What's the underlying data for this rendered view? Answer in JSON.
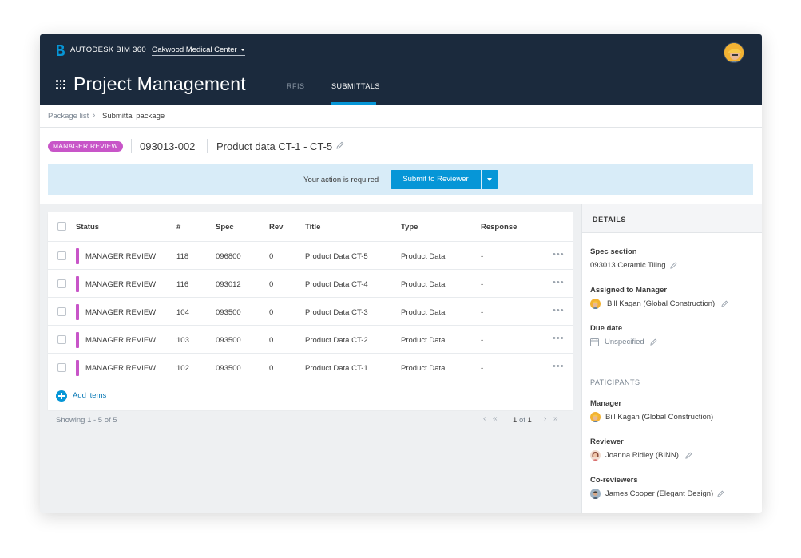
{
  "header": {
    "brand": "AUTODESK BIM 360",
    "project": "Oakwood Medical Center",
    "app_title": "Project Management",
    "tabs": [
      {
        "label": "RFIS",
        "active": false
      },
      {
        "label": "SUBMITTALS",
        "active": true
      }
    ]
  },
  "breadcrumb": {
    "parent": "Package list",
    "current": "Submittal package"
  },
  "package": {
    "status": "MANAGER REVIEW",
    "id": "093013-002",
    "title": "Product data CT-1 - CT-5"
  },
  "action": {
    "message": "Your action is required",
    "button": "Submit to Reviewer"
  },
  "table": {
    "columns": [
      "Status",
      "#",
      "Spec",
      "Rev",
      "Title",
      "Type",
      "Response"
    ],
    "rows": [
      {
        "status": "MANAGER REVIEW",
        "num": "118",
        "spec": "096800",
        "rev": "0",
        "title": "Product Data CT-5",
        "type": "Product Data",
        "response": "-"
      },
      {
        "status": "MANAGER REVIEW",
        "num": "116",
        "spec": "093012",
        "rev": "0",
        "title": "Product Data CT-4",
        "type": "Product Data",
        "response": "-"
      },
      {
        "status": "MANAGER REVIEW",
        "num": "104",
        "spec": "093500",
        "rev": "0",
        "title": "Product Data CT-3",
        "type": "Product Data",
        "response": "-"
      },
      {
        "status": "MANAGER REVIEW",
        "num": "103",
        "spec": "093500",
        "rev": "0",
        "title": "Product Data CT-2",
        "type": "Product Data",
        "response": "-"
      },
      {
        "status": "MANAGER REVIEW",
        "num": "102",
        "spec": "093500",
        "rev": "0",
        "title": "Product Data CT-1",
        "type": "Product Data",
        "response": "-"
      }
    ],
    "add_label": "Add items"
  },
  "pagination": {
    "showing": "Showing 1 - 5 of 5",
    "page": "1",
    "of_label": "of",
    "total": "1"
  },
  "details": {
    "title": "DETAILS",
    "spec_section_label": "Spec section",
    "spec_section_value": "093013 Ceramic Tiling",
    "assigned_label": "Assigned to Manager",
    "assigned_value": "Bill Kagan (Global Construction)",
    "due_label": "Due date",
    "due_value": "Unspecified",
    "participants_title": "PATICIPANTS",
    "manager_label": "Manager",
    "manager_value": "Bill Kagan (Global Construction)",
    "reviewer_label": "Reviewer",
    "reviewer_value": "Joanna Ridley (BINN)",
    "coreviewers_label": "Co-reviewers",
    "coreviewers_value": "James Cooper (Elegant Design)"
  },
  "colors": {
    "header_bg": "#1b2a3d",
    "accent": "#0696d7",
    "status": "#c855c8",
    "banner_bg": "#d8ecf8"
  }
}
